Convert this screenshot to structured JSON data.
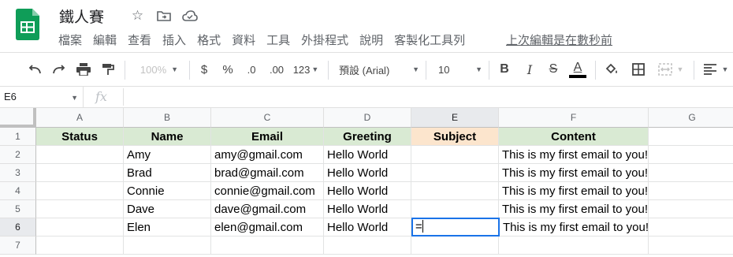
{
  "doc": {
    "title": "鐵人賽",
    "menu": [
      "檔案",
      "編輯",
      "查看",
      "插入",
      "格式",
      "資料",
      "工具",
      "外掛程式",
      "說明",
      "客製化工具列"
    ],
    "last_edit": "上次編輯是在數秒前"
  },
  "toolbar": {
    "zoom": "100%",
    "currency": "$",
    "percent": "%",
    "dec_less": ".0",
    "dec_more": ".00",
    "format_more": "123",
    "font": "預設 (Arial)",
    "size": "10",
    "bold": "B",
    "italic": "I",
    "strike": "S",
    "text_color_letter": "A"
  },
  "formula_bar": {
    "name_box": "E6",
    "fx": "fx",
    "value": ""
  },
  "grid": {
    "columns": [
      "A",
      "B",
      "C",
      "D",
      "E",
      "F",
      "G"
    ],
    "rows": [
      "1",
      "2",
      "3",
      "4",
      "5",
      "6",
      "7"
    ],
    "headers": [
      "Status",
      "Name",
      "Email",
      "Greeting",
      "Subject",
      "Content"
    ],
    "data": [
      [
        "",
        "Amy",
        "amy@gmail.com",
        "Hello World",
        "",
        "This is my first email to you!"
      ],
      [
        "",
        "Brad",
        "brad@gmail.com",
        "Hello World",
        "",
        "This is my first email to you!"
      ],
      [
        "",
        "Connie",
        "connie@gmail.com",
        "Hello World",
        "",
        "This is my first email to you!"
      ],
      [
        "",
        "Dave",
        "dave@gmail.com",
        "Hello World",
        "",
        "This is my first email to you!"
      ],
      [
        "",
        "Elen",
        "elen@gmail.com",
        "Hello World",
        "=",
        "This is my first email to you!"
      ]
    ],
    "active_cell": "E6",
    "active_value": "="
  },
  "colors": {
    "header_green": "#d9ead3",
    "header_orange": "#fce5cd",
    "selection_blue": "#1a73e8",
    "logo_green": "#0f9d58"
  }
}
